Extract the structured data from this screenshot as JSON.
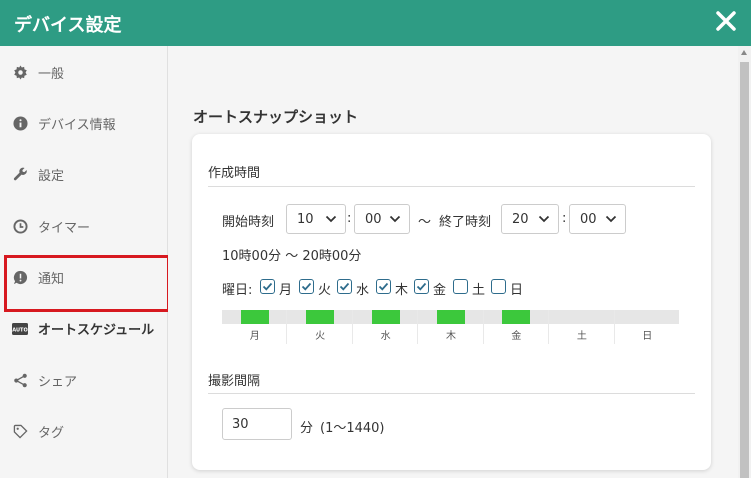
{
  "header": {
    "title": "デバイス設定",
    "close_icon": "close-icon"
  },
  "sidebar": {
    "items": [
      {
        "label": "一般",
        "icon": "gear-icon"
      },
      {
        "label": "デバイス情報",
        "icon": "info-icon"
      },
      {
        "label": "設定",
        "icon": "wrench-icon"
      },
      {
        "label": "タイマー",
        "icon": "clock-icon"
      },
      {
        "label": "通知",
        "icon": "notification-icon"
      },
      {
        "label": "オートスケジュール",
        "icon": "auto-icon",
        "active": true
      },
      {
        "label": "シェア",
        "icon": "share-icon"
      },
      {
        "label": "タグ",
        "icon": "tag-icon"
      }
    ]
  },
  "main": {
    "section_title": "オートスナップショット",
    "creation_time": {
      "heading": "作成時間",
      "start_label": "開始時刻",
      "start_hour": "10",
      "start_minute": "00",
      "colon": ":",
      "tilde": "〜",
      "end_label": "終了時刻",
      "end_hour": "20",
      "end_minute": "00",
      "summary": "10時00分 〜 20時00分"
    },
    "days": {
      "label": "曜日:",
      "items": [
        {
          "label": "月",
          "checked": true
        },
        {
          "label": "火",
          "checked": true
        },
        {
          "label": "水",
          "checked": true
        },
        {
          "label": "木",
          "checked": true
        },
        {
          "label": "金",
          "checked": true
        },
        {
          "label": "土",
          "checked": false
        },
        {
          "label": "日",
          "checked": false
        }
      ]
    },
    "timeline": {
      "days": [
        "月",
        "火",
        "水",
        "木",
        "金",
        "土",
        "日"
      ],
      "active": [
        true,
        true,
        true,
        true,
        true,
        false,
        false
      ],
      "active_color": "#3cc83c"
    },
    "interval": {
      "heading": "撮影間隔",
      "value": "30",
      "unit": "分",
      "range": "(1〜1440)"
    }
  },
  "colors": {
    "header": "#2e9c84",
    "highlight": "#d71920",
    "checkbox": "#2e6c8c"
  }
}
